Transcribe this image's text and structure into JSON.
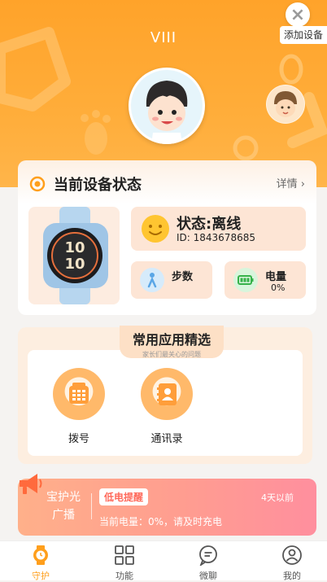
{
  "header": {
    "title": "VIII",
    "add_device_label": "添加设备"
  },
  "status": {
    "title": "当前设备状态",
    "detail_label": "详情",
    "state_label": "状态:离线",
    "device_id": "ID: 1843678685",
    "steps_label": "步数",
    "battery_label": "电量",
    "battery_value": "0%",
    "watch_time": "10 10"
  },
  "apps": {
    "title": "常用应用精选",
    "subtitle": "家长们最关心的问题",
    "items": [
      {
        "label": "拨号"
      },
      {
        "label": "通讯录"
      }
    ]
  },
  "notice": {
    "brand": "宝护光广播",
    "badge": "低电提醒",
    "time": "4天以前",
    "message": "当前电量：0%，请及时充电"
  },
  "tabbar": {
    "items": [
      {
        "label": "守护",
        "icon": "watch-icon",
        "active": true
      },
      {
        "label": "功能",
        "icon": "grid-icon",
        "active": false
      },
      {
        "label": "微聊",
        "icon": "chat-icon",
        "active": false
      },
      {
        "label": "我的",
        "icon": "profile-icon",
        "active": false
      }
    ]
  },
  "colors": {
    "accent": "#ff9f1c",
    "hero": "#ffa32a",
    "notice": "#ff9d90"
  }
}
